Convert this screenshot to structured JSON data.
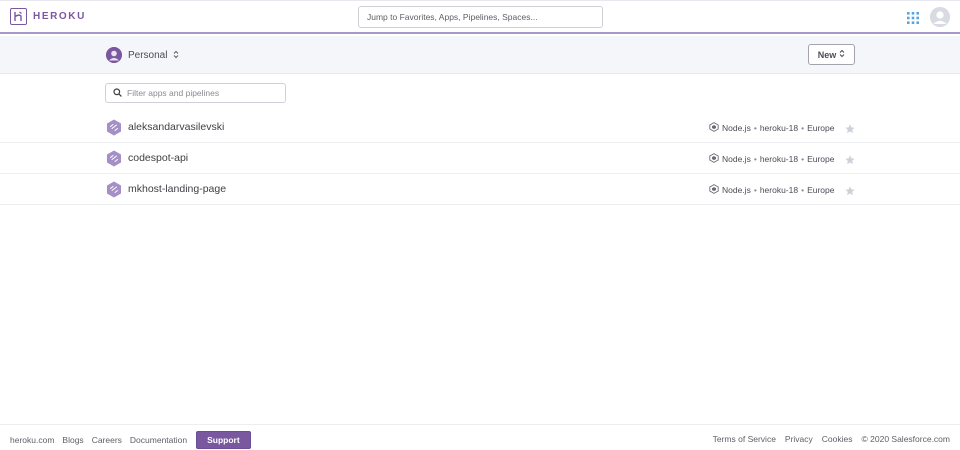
{
  "header": {
    "logo_text": "HEROKU",
    "search_placeholder": "Jump to Favorites, Apps, Pipelines, Spaces..."
  },
  "subheader": {
    "account_label": "Personal",
    "new_button_label": "New"
  },
  "filter": {
    "placeholder": "Filter apps and pipelines"
  },
  "apps": [
    {
      "name": "aleksandarvasilevski",
      "language": "Node.js",
      "stack": "heroku-18",
      "region": "Europe"
    },
    {
      "name": "codespot-api",
      "language": "Node.js",
      "stack": "heroku-18",
      "region": "Europe"
    },
    {
      "name": "mkhost-landing-page",
      "language": "Node.js",
      "stack": "heroku-18",
      "region": "Europe"
    }
  ],
  "footer": {
    "links_left": [
      "heroku.com",
      "Blogs",
      "Careers",
      "Documentation"
    ],
    "support_label": "Support",
    "links_right": [
      "Terms of Service",
      "Privacy",
      "Cookies"
    ],
    "copyright": "© 2020 Salesforce.com"
  },
  "colors": {
    "brand": "#79589f",
    "header_border": "#a699c8",
    "subheader_bg": "#f4f6fa"
  }
}
